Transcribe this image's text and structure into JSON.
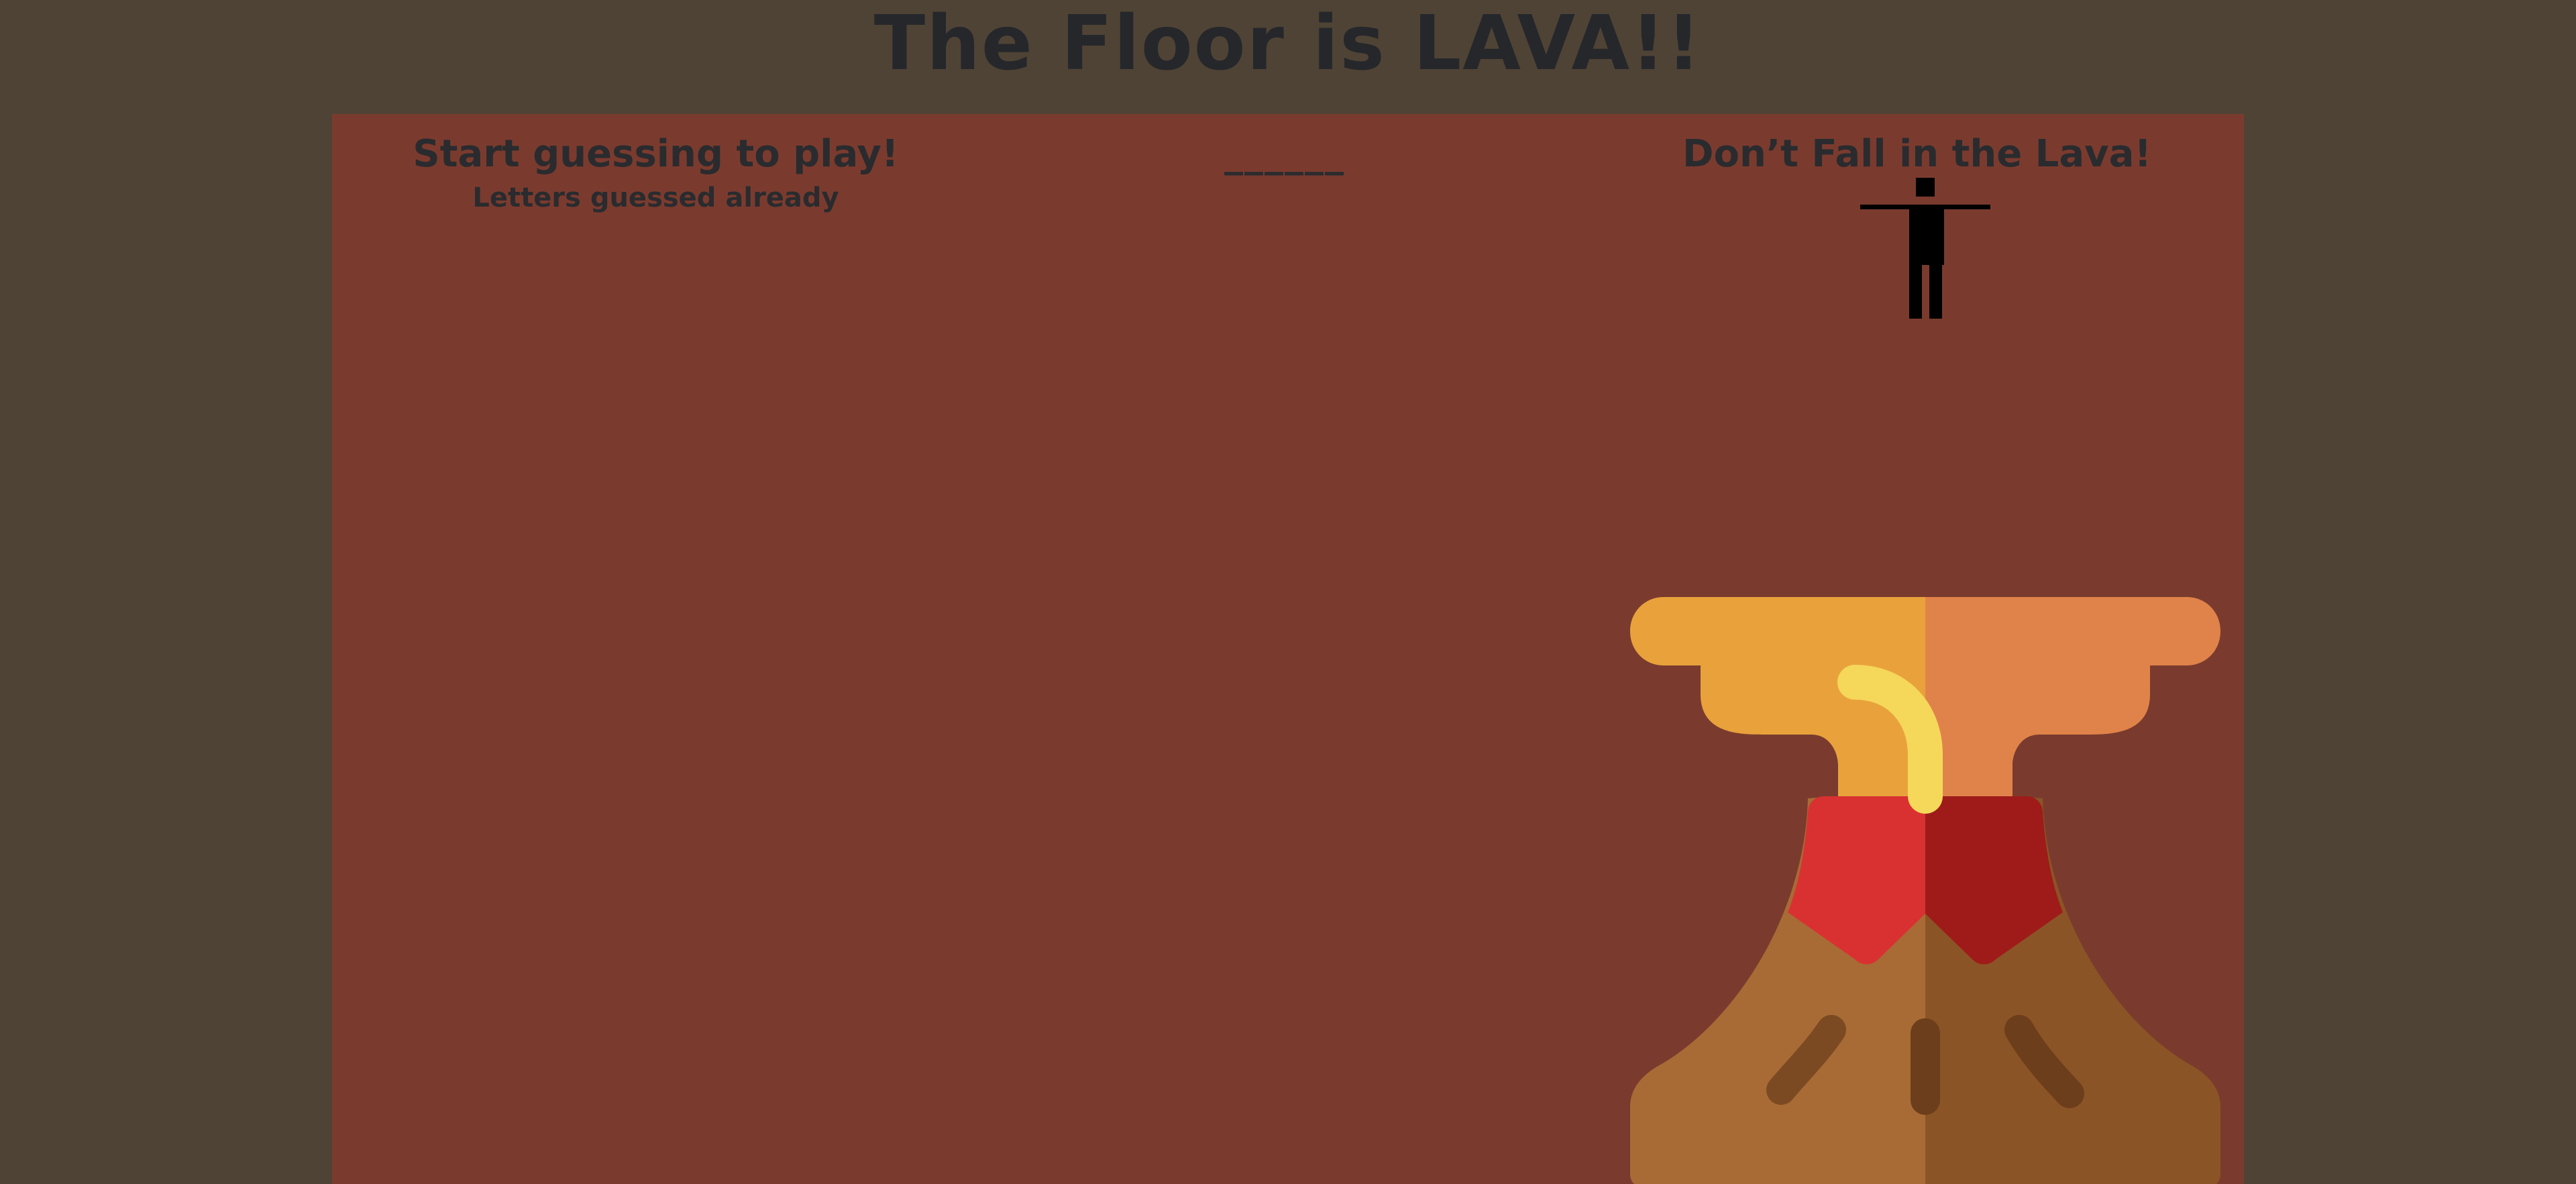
{
  "title": "The Floor is LAVA!!",
  "game": {
    "status": "Start guessing to play!",
    "guessed_label": "Letters guessed already",
    "guessed_letters": [],
    "word_display": "______",
    "warning": "Don’t Fall in the Lava!"
  },
  "icons": {
    "figure": "stick-figure-icon",
    "volcano": "volcano-icon"
  },
  "colors": {
    "page_background": "#4f4335",
    "board_background": "#7a3b2e",
    "text": "#2a2b2e",
    "lava_light": "#e9a23b",
    "lava_dark": "#e0834a",
    "lava_glow": "#f5d75a",
    "crater_red": "#d93131",
    "crater_dark_red": "#9e1b19",
    "mountain_light": "#a86b35",
    "mountain_dark": "#8b5426"
  }
}
